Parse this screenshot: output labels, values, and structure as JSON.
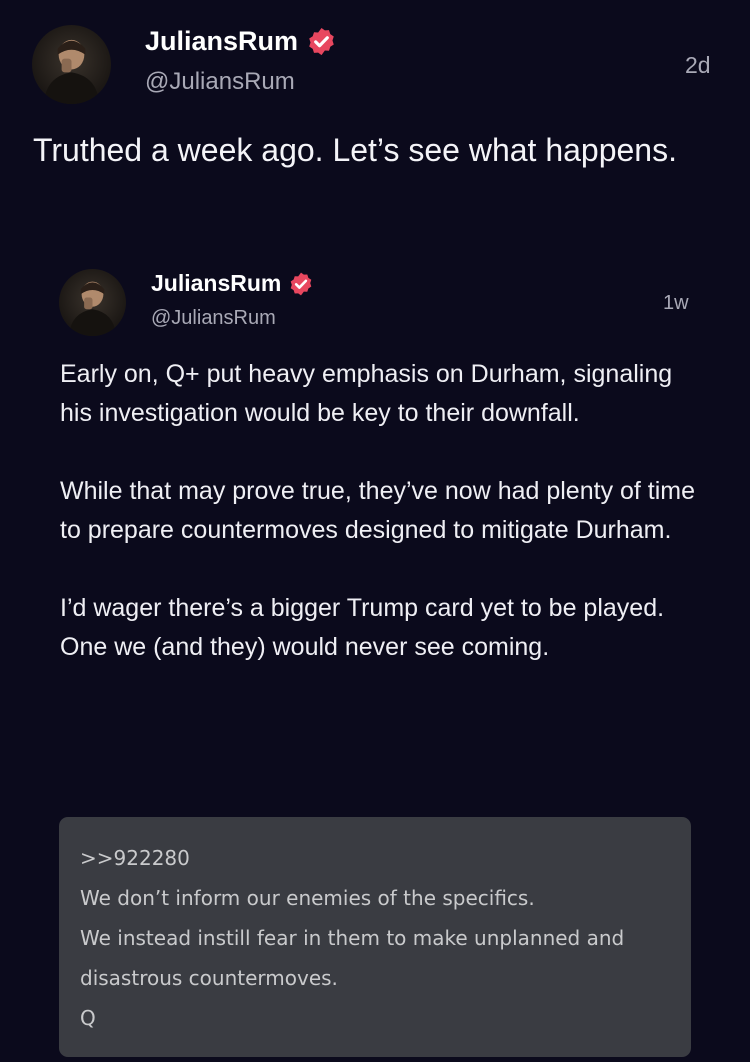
{
  "post": {
    "display_name": "JuliansRum",
    "handle": "@JuliansRum",
    "time": "2d",
    "text": "Truthed a week ago. Let’s see what happens.",
    "avatar_icon": "user-avatar"
  },
  "quoted_post": {
    "display_name": "JuliansRum",
    "handle": "@JuliansRum",
    "time": "1w",
    "paragraphs": [
      "Early on, Q+ put heavy emphasis on Durham, signaling his investigation would be key to their downfall.",
      "While that may prove true, they’ve now had plenty of time to prepare countermoves designed to mitigate Durham.",
      "I’d wager there’s a bigger Trump card yet to be played. One we (and they) would never see coming."
    ],
    "image_lines": [
      ">>922280",
      "We don’t inform our enemies of the specifics.",
      "We instead instill fear in them to make unplanned and",
      "disastrous countermoves.",
      "Q"
    ]
  },
  "colors": {
    "background": "#0b0a1c",
    "verified_badge": "#e8475f",
    "muted_text": "#a9a9b6",
    "image_card": "#3a3c42"
  }
}
